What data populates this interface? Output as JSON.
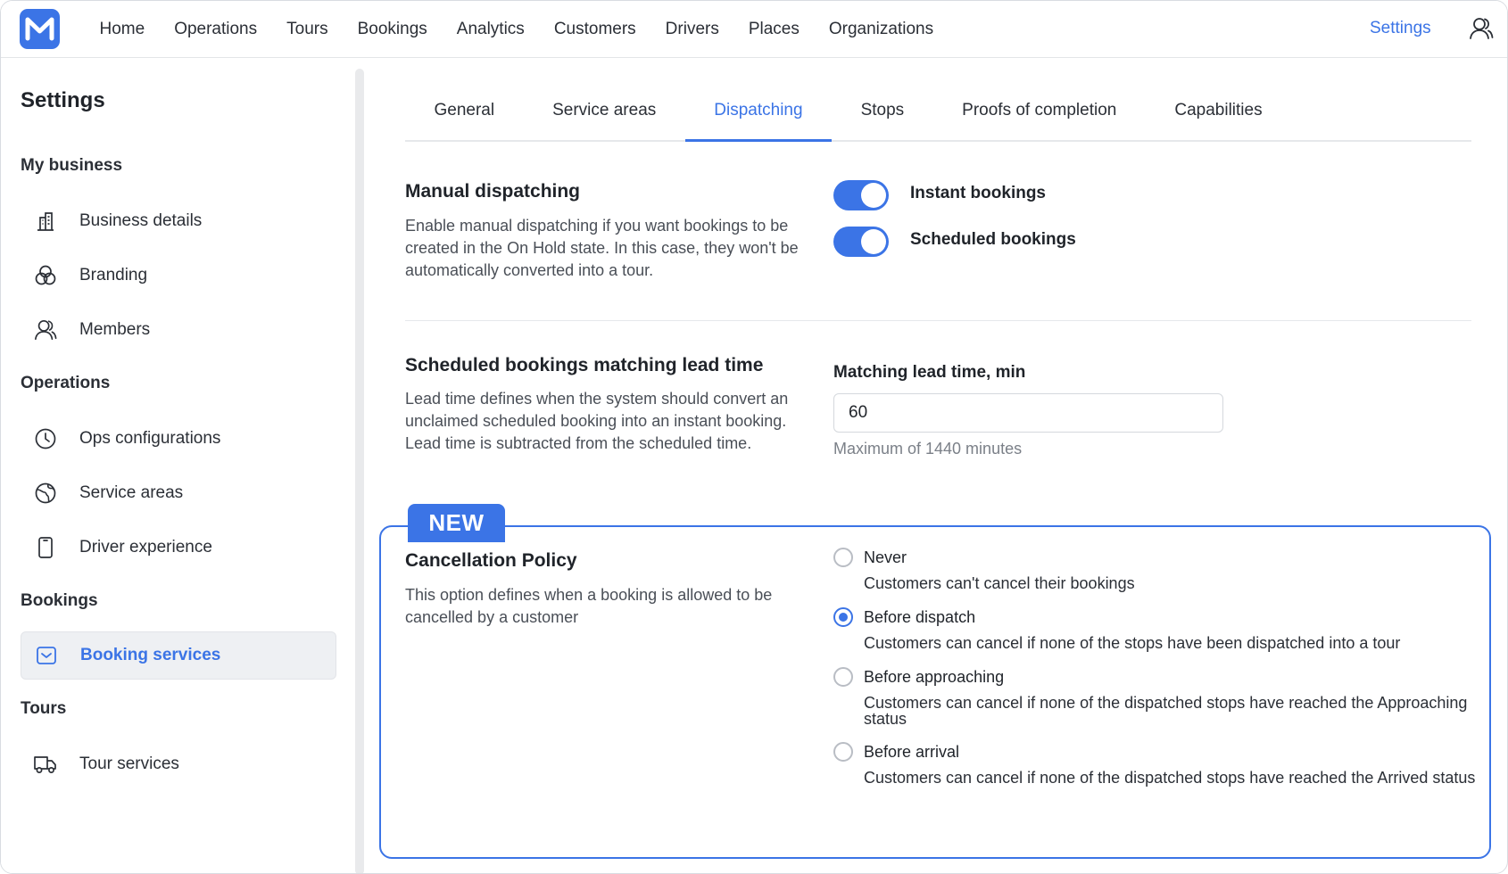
{
  "nav": {
    "items": [
      "Home",
      "Operations",
      "Tours",
      "Bookings",
      "Analytics",
      "Customers",
      "Drivers",
      "Places",
      "Organizations"
    ],
    "settings": "Settings"
  },
  "sidebar": {
    "title": "Settings",
    "groups": {
      "my_business": "My business",
      "operations": "Operations",
      "bookings": "Bookings",
      "tours": "Tours"
    },
    "items": {
      "business_details": "Business details",
      "branding": "Branding",
      "members": "Members",
      "ops_configurations": "Ops configurations",
      "service_areas": "Service areas",
      "driver_experience": "Driver experience",
      "booking_services": "Booking services",
      "tour_services": "Tour services"
    }
  },
  "tabs": [
    "General",
    "Service areas",
    "Dispatching",
    "Stops",
    "Proofs of completion",
    "Capabilities"
  ],
  "active_tab": "Dispatching",
  "manual_dispatching": {
    "title": "Manual dispatching",
    "description": "Enable manual dispatching if you want bookings to be created in the On Hold state. In this case, they won't be automatically converted into a tour.",
    "instant_label": "Instant bookings",
    "instant_on": true,
    "scheduled_label": "Scheduled bookings",
    "scheduled_on": true
  },
  "lead_time": {
    "title": "Scheduled bookings matching lead time",
    "description": "Lead time defines when the system should convert an unclaimed scheduled booking into an instant booking. Lead time is subtracted from the scheduled time.",
    "field_label": "Matching lead time, min",
    "value": "60",
    "hint": "Maximum of 1440 minutes"
  },
  "cancellation": {
    "badge": "NEW",
    "title": "Cancellation Policy",
    "description": "This option defines when a booking is allowed to be cancelled by a customer",
    "options": [
      {
        "label": "Never",
        "desc": "Customers can't cancel their bookings",
        "selected": false
      },
      {
        "label": "Before dispatch",
        "desc": "Customers can cancel if none of the stops have been dispatched into a tour",
        "selected": true
      },
      {
        "label": "Before approaching",
        "desc": "Customers can cancel if none of the dispatched stops have reached the Approaching status",
        "selected": false
      },
      {
        "label": "Before arrival",
        "desc": "Customers can cancel if none of the dispatched stops have reached the Arrived status",
        "selected": false
      }
    ]
  },
  "colors": {
    "accent": "#3b74e6",
    "text": "#1f2329",
    "muted": "#7b8088"
  }
}
